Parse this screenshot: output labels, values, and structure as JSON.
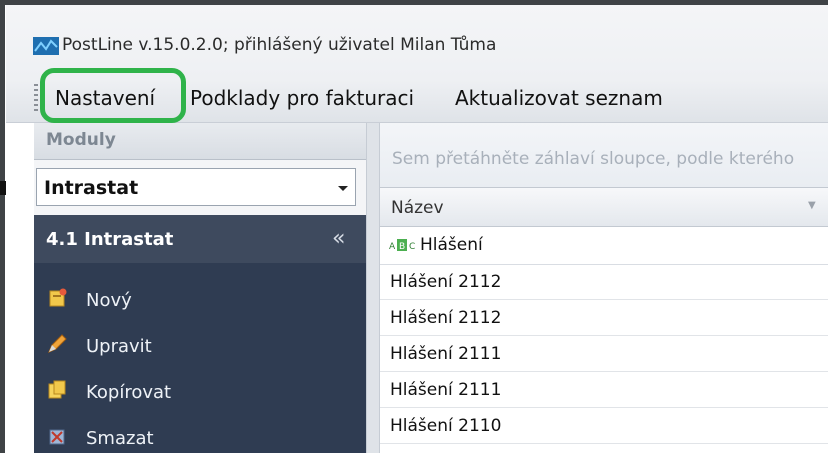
{
  "window": {
    "title": "PostLine v.15.0.2.0; přihlášený uživatel Milan Tůma"
  },
  "menu": {
    "items": [
      "Nastavení",
      "Podklady pro fakturaci",
      "Aktualizovat seznam"
    ]
  },
  "left_panel": {
    "header": "Moduly",
    "module_select": {
      "value": "Intrastat"
    },
    "section": {
      "title": "4.1  Intrastat",
      "collapse_glyph": "«"
    },
    "actions": [
      {
        "label": "Nový",
        "icon": "new-icon"
      },
      {
        "label": "Upravit",
        "icon": "edit-icon"
      },
      {
        "label": "Kopírovat",
        "icon": "copy-icon"
      },
      {
        "label": "Smazat",
        "icon": "delete-icon"
      }
    ]
  },
  "grid": {
    "group_hint": "Sem přetáhněte záhlaví sloupce, podle kterého",
    "column": "Název",
    "filter_label": "Hlášení",
    "rows": [
      "Hlášení 2112",
      "Hlášení 2112",
      "Hlášení 2111",
      "Hlášení 2111",
      "Hlášení 2110"
    ]
  },
  "colors": {
    "highlight": "#2fb34a",
    "nav_background": "#2f3c52",
    "nav_header": "#3e4a5e"
  }
}
